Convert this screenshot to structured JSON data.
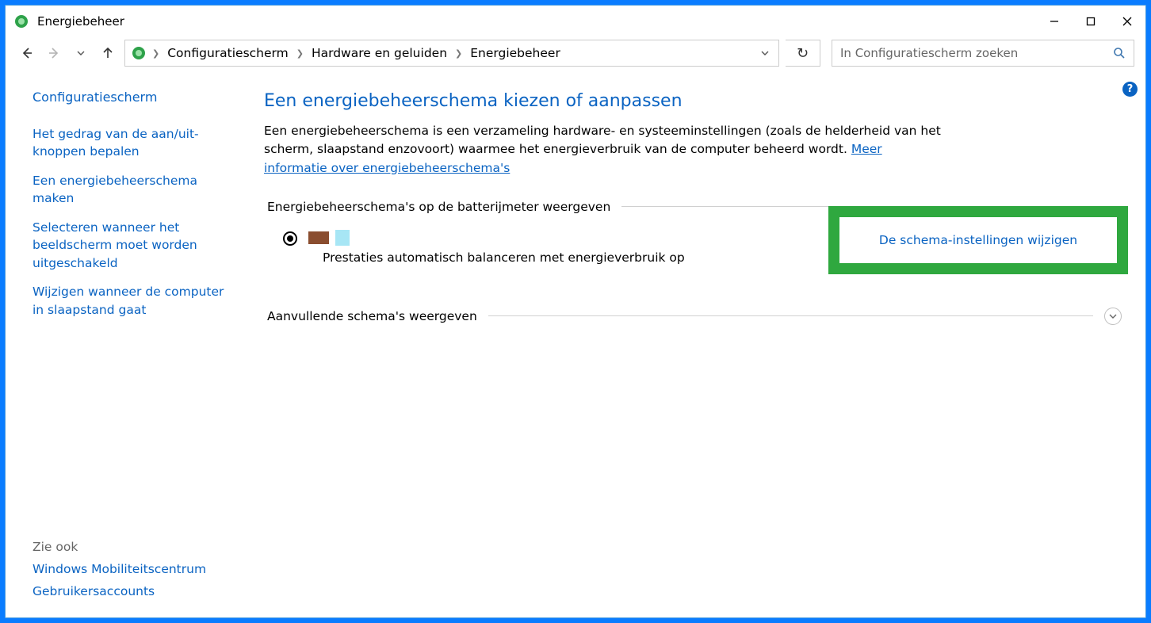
{
  "window": {
    "title": "Energiebeheer"
  },
  "breadcrumbs": {
    "b0": "Configuratiescherm",
    "b1": "Hardware en geluiden",
    "b2": "Energiebeheer"
  },
  "search": {
    "placeholder": "In Configuratiescherm zoeken"
  },
  "sidebar": {
    "home": "Configuratiescherm",
    "links": {
      "l0": "Het gedrag van de aan/uit-knoppen bepalen",
      "l1": "Een energiebeheerschema maken",
      "l2": "Selecteren wanneer het beeldscherm moet worden uitgeschakeld",
      "l3": "Wijzigen wanneer de computer in slaapstand gaat"
    },
    "seeAlsoTitle": "Zie ook",
    "seeAlso": {
      "s0": "Windows Mobiliteitscentrum",
      "s1": "Gebruikersaccounts"
    }
  },
  "main": {
    "heading": "Een energiebeheerschema kiezen of aanpassen",
    "descPre": "Een energiebeheerschema is een verzameling hardware- en systeeminstellingen (zoals de helderheid van het scherm, slaapstand enzovoort) waarmee het energieverbruik van de computer beheerd wordt. ",
    "descLink": "Meer informatie over energiebeheerschema's",
    "section1": "Energiebeheerschema's op de batterijmeter weergeven",
    "plan": {
      "description": "Prestaties automatisch balanceren met energieverbruik op",
      "changeLink": "De schema-instellingen wijzigen"
    },
    "section2": "Aanvullende schema's weergeven"
  }
}
